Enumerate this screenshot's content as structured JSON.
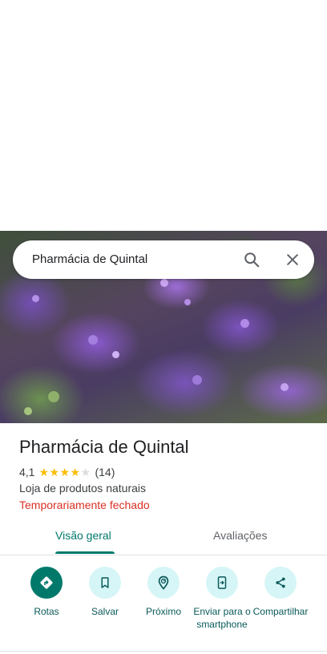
{
  "search": {
    "query": "Pharmácia de Quintal",
    "search_icon": "search-icon",
    "close_icon": "close-icon"
  },
  "hero": {
    "description_icon": "place-photo"
  },
  "place": {
    "name": "Pharmácia de Quintal",
    "rating": "4,1",
    "rating_stars": 4,
    "rating_max": 5,
    "review_count": "(14)",
    "category": "Loja de produtos naturais",
    "status": "Temporariamente fechado"
  },
  "tabs": [
    {
      "label": "Visão geral",
      "active": true
    },
    {
      "label": "Avaliações",
      "active": false
    }
  ],
  "actions": [
    {
      "label": "Rotas",
      "icon": "directions-icon"
    },
    {
      "label": "Salvar",
      "icon": "bookmark-icon"
    },
    {
      "label": "Próximo",
      "icon": "nearby-icon"
    },
    {
      "label": "Enviar para o smartphone",
      "icon": "send-to-phone-icon"
    },
    {
      "label": "Compartilhar",
      "icon": "share-icon"
    }
  ],
  "colors": {
    "accent": "#00796b",
    "action_bg": "#d6f5f7",
    "status_closed": "#d93025",
    "star": "#fbbc04"
  }
}
